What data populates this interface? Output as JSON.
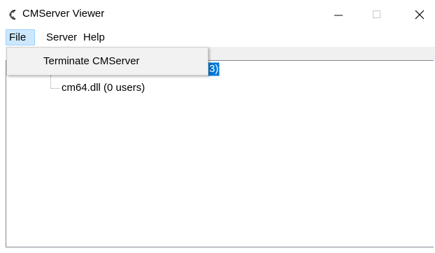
{
  "window": {
    "title": "CMServer Viewer",
    "icon": "cmserver-app-icon",
    "controls": {
      "minimize_icon": "minimize-icon",
      "maximize_icon": "maximize-icon",
      "close_icon": "close-icon"
    }
  },
  "menubar": {
    "items": [
      {
        "label": "File",
        "active": true
      },
      {
        "label": "Server"
      },
      {
        "label": "Help"
      }
    ]
  },
  "file_menu": {
    "items": [
      {
        "label": "Terminate CMServer"
      }
    ]
  },
  "tree": {
    "root_visible_suffix": "3)",
    "children": [
      {
        "label": "cm64.dll (0 users)"
      }
    ]
  },
  "colors": {
    "selection": "#0078d7",
    "menu_highlight": "#cce8ff",
    "menu_bg": "#f2f2f2"
  }
}
